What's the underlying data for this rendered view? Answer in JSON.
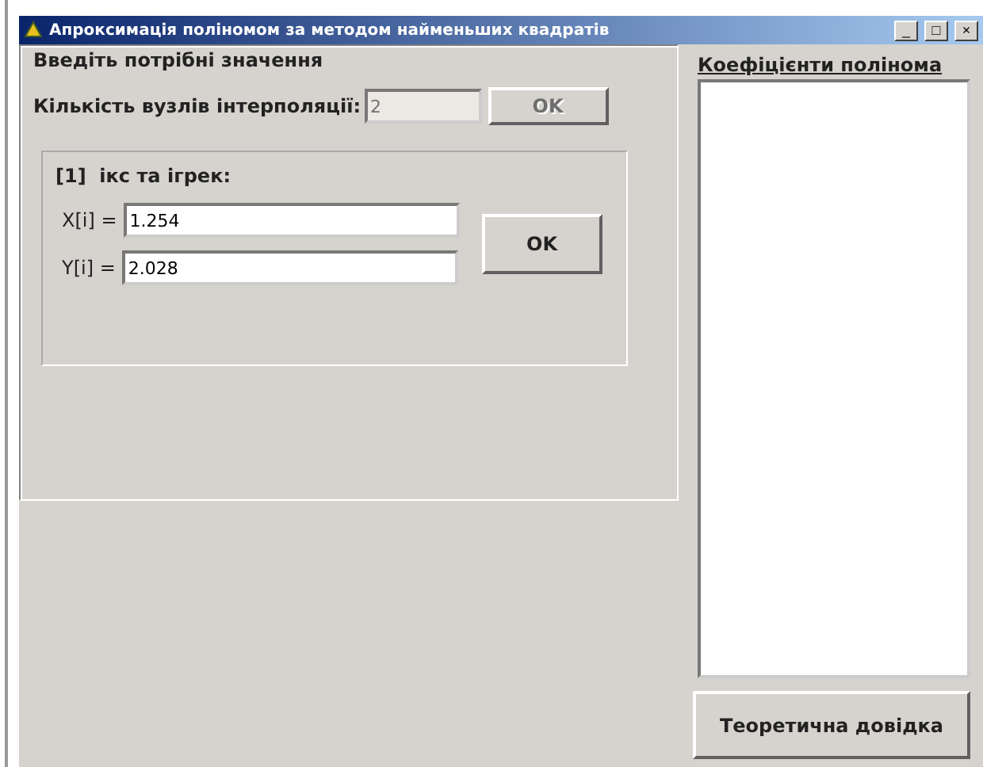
{
  "window": {
    "title": "Апроксимація поліномом за методом найменьших квадратів",
    "controls": [
      "_",
      "□",
      "×"
    ]
  },
  "input_group": {
    "title": "Введіть потрібні значення",
    "count_label": "Кількість вузлів інтерполяції:",
    "count_value": "2",
    "count_disabled": true,
    "count_button": {
      "label": "OK",
      "disabled": true
    },
    "point_group": {
      "title": "[1]  ікс та ігрек:",
      "fields": [
        {
          "label": "X[i] =",
          "value": "1.254"
        },
        {
          "label": "Y[i] =",
          "value": "2.028"
        }
      ],
      "button": {
        "label": "OK",
        "disabled": false
      }
    }
  },
  "coefficients": {
    "title": "Коефіцієнти полінома"
  },
  "help_button": {
    "label": "Теоретична довідка"
  }
}
